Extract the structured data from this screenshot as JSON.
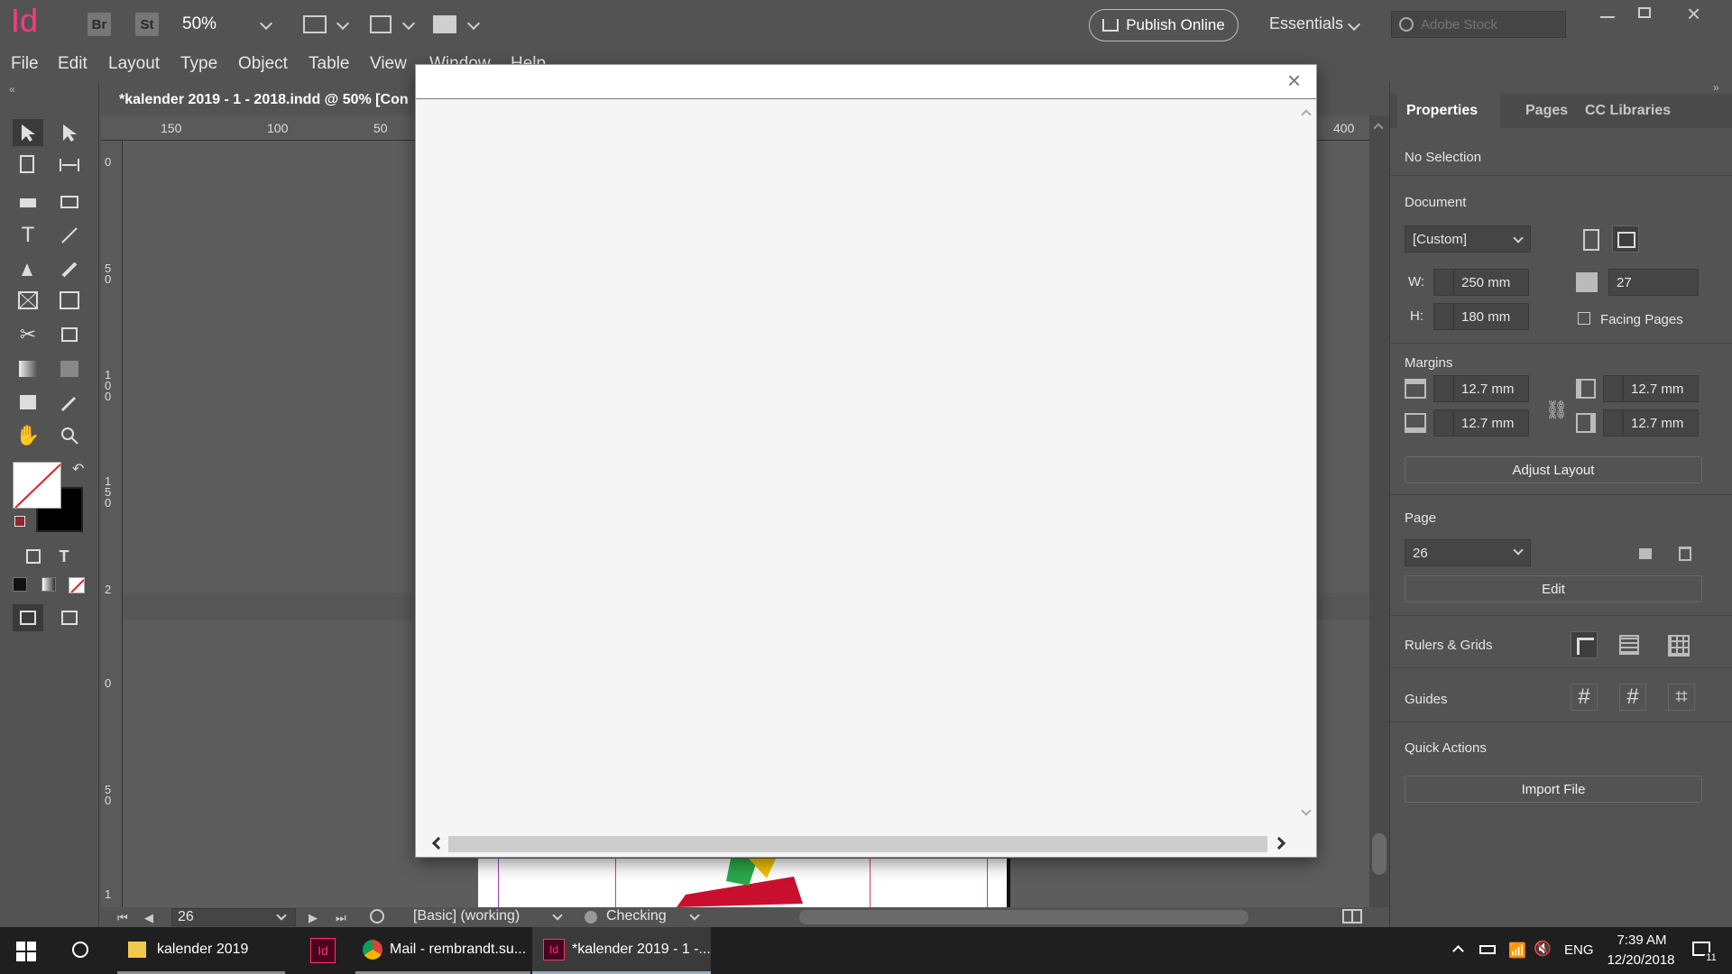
{
  "app": {
    "logo": "Id",
    "bridge_label": "Br",
    "stock_label": "St",
    "zoom": "50%",
    "publish_label": "Publish Online",
    "workspace_label": "Essentials",
    "search_placeholder": "Adobe Stock"
  },
  "menu": [
    "File",
    "Edit",
    "Layout",
    "Type",
    "Object",
    "Table",
    "View",
    "Window",
    "Help"
  ],
  "document_tab": "*kalender 2019 - 1 - 2018.indd @ 50% [Con",
  "rulers": {
    "top": [
      "150",
      "100",
      "50",
      "400"
    ],
    "left": [
      "0",
      "5\n0",
      "1\n0\n0",
      "1\n5\n0",
      "2",
      "0",
      "5\n0",
      "1"
    ]
  },
  "right_panel": {
    "tabs": [
      "Properties",
      "Pages",
      "CC Libraries"
    ],
    "selection": "No Selection",
    "document_heading": "Document",
    "preset": "[Custom]",
    "w_label": "W:",
    "h_label": "H:",
    "width": "250 mm",
    "height": "180 mm",
    "pages_count": "27",
    "facing_pages": "Facing Pages",
    "margins_heading": "Margins",
    "margin_top": "12.7 mm",
    "margin_bottom": "12.7 mm",
    "margin_left": "12.7 mm",
    "margin_right": "12.7 mm",
    "adjust_layout": "Adjust Layout",
    "page_heading": "Page",
    "page_value": "26",
    "edit_label": "Edit",
    "rulers_grids": "Rulers & Grids",
    "guides": "Guides",
    "quick_actions": "Quick Actions",
    "import_file": "Import File"
  },
  "status": {
    "page": "26",
    "style": "[Basic] (working)",
    "preflight": "Checking"
  },
  "taskbar": {
    "items": [
      "kalender 2019",
      "",
      "Mail - rembrandt.su...",
      "*kalender 2019 - 1 -..."
    ],
    "lang": "ENG",
    "time": "7:39 AM",
    "date": "12/20/2018",
    "notifications": "11"
  },
  "colors": {
    "indesign_pink": "#ff3366",
    "panel_bg": "#535353",
    "modal_bg": "#f5f5f5",
    "taskbar_bg": "#1f1f1f"
  }
}
